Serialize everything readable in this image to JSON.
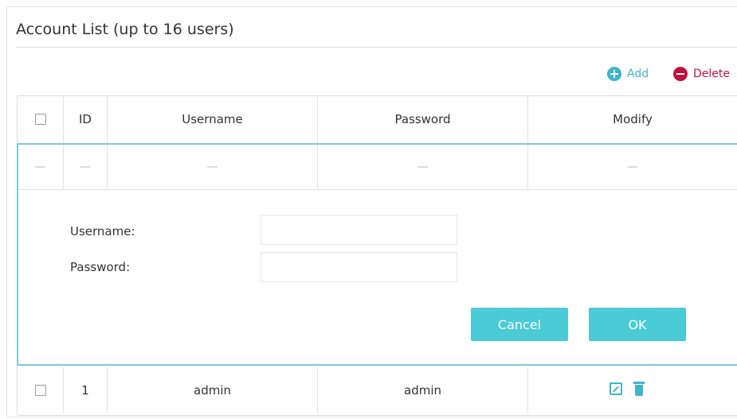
{
  "title": "Account List (up to 16 users)",
  "toolbar": {
    "add_label": "Add",
    "delete_label": "Delete"
  },
  "columns": [
    "ID",
    "Username",
    "Password",
    "Modify"
  ],
  "placeholder_row": {
    "dash": "—"
  },
  "form": {
    "username_label": "Username:",
    "password_label": "Password:",
    "username_value": "",
    "password_value": "",
    "cancel_label": "Cancel",
    "ok_label": "OK"
  },
  "rows": [
    {
      "id": "1",
      "username": "admin",
      "password": "admin"
    }
  ],
  "colors": {
    "accent": "#4acbd6",
    "delete": "#c0123f",
    "panel_border": "#7ecbd6"
  }
}
